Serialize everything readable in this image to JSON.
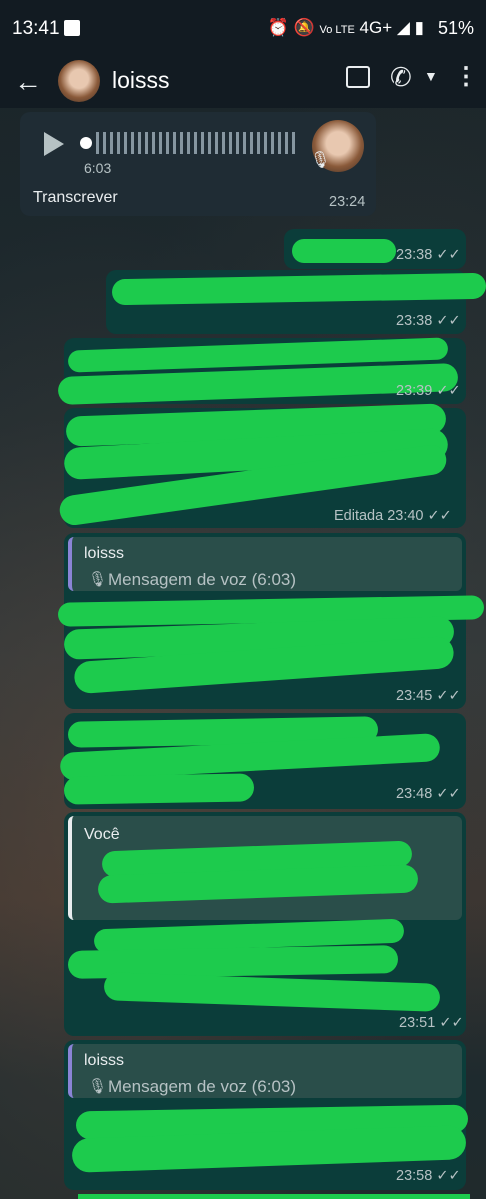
{
  "status": {
    "time": "13:41",
    "battery": "51%",
    "network": "4G+"
  },
  "header": {
    "contact_name": "loisss"
  },
  "voice_msg": {
    "duration": "6:03",
    "transcribe_label": "Transcrever",
    "time": "23:24"
  },
  "messages": [
    {
      "time": "23:38 ✓✓"
    },
    {
      "time": "23:38 ✓✓"
    },
    {
      "time": "23:39 ✓✓"
    },
    {
      "time": "Editada 23:40 ✓✓"
    },
    {
      "time": "23:45 ✓✓"
    },
    {
      "time": "23:48 ✓✓"
    },
    {
      "time": "23:51 ✓✓"
    },
    {
      "time": "23:58 ✓✓"
    }
  ],
  "quotes": [
    {
      "author": "loisss",
      "text": "Mensagem de voz (6:03)"
    },
    {
      "author": "Você"
    },
    {
      "author": "loisss",
      "text": "Mensagem de voz (6:03)"
    }
  ],
  "colors": {
    "incoming": "#1f2c34",
    "outgoing": "#0b3d3a",
    "redaction": "#1dcb4d",
    "header": "#121b22"
  }
}
